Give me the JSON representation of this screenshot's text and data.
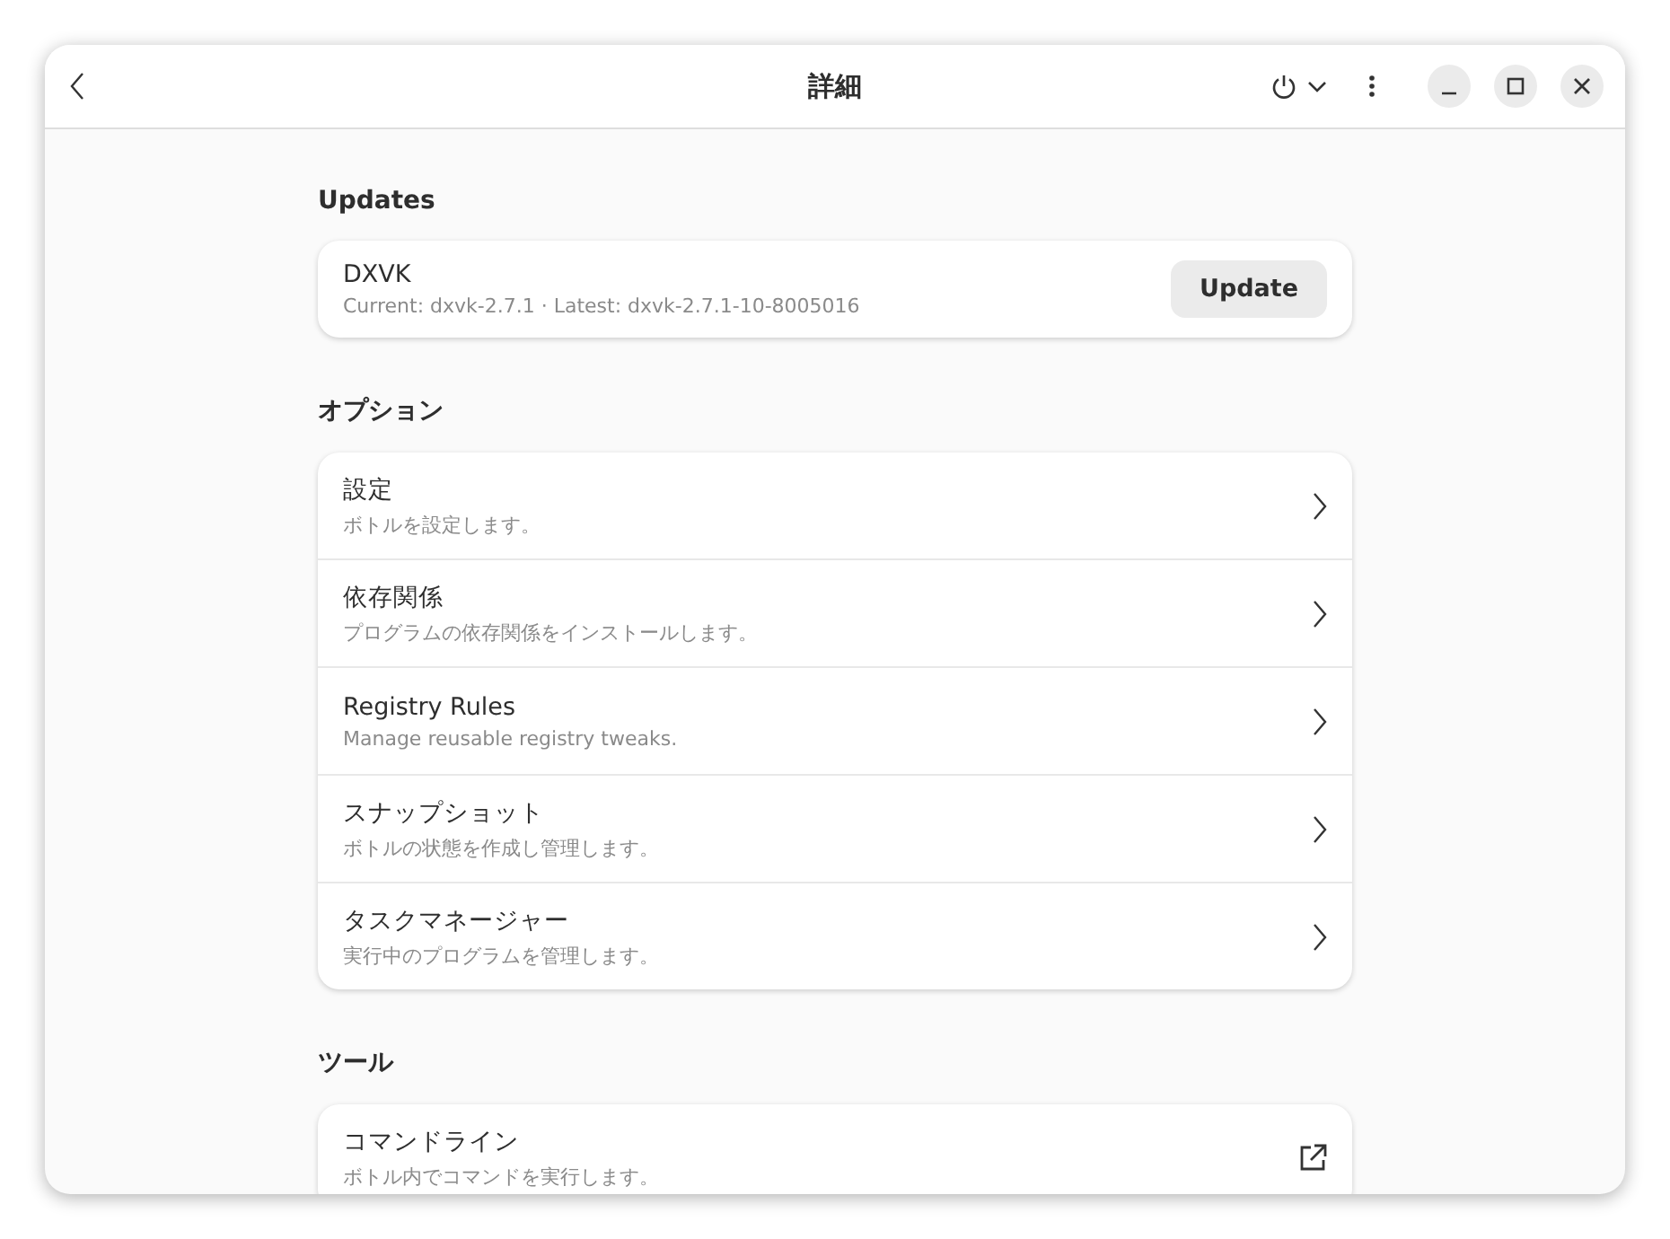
{
  "window": {
    "title": "詳細"
  },
  "updates": {
    "heading": "Updates",
    "item": {
      "title": "DXVK",
      "subtitle": "Current: dxvk-2.7.1 · Latest: dxvk-2.7.1-10-8005016",
      "button": "Update"
    }
  },
  "options": {
    "heading": "オプション",
    "rows": [
      {
        "title": "設定",
        "subtitle": "ボトルを設定します。",
        "kind": "nav"
      },
      {
        "title": "依存関係",
        "subtitle": "プログラムの依存関係をインストールします。",
        "kind": "nav"
      },
      {
        "title": "Registry Rules",
        "subtitle": "Manage reusable registry tweaks.",
        "kind": "nav"
      },
      {
        "title": "スナップショット",
        "subtitle": "ボトルの状態を作成し管理します。",
        "kind": "nav"
      },
      {
        "title": "タスクマネージャー",
        "subtitle": "実行中のプログラムを管理します。",
        "kind": "nav"
      }
    ]
  },
  "tools": {
    "heading": "ツール",
    "rows": [
      {
        "title": "コマンドライン",
        "subtitle": "ボトル内でコマンドを実行します。",
        "kind": "external"
      }
    ]
  }
}
